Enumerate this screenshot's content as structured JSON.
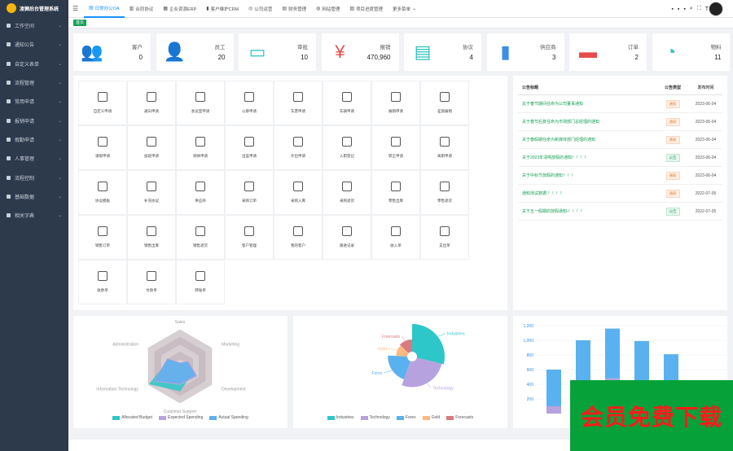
{
  "app": {
    "title": "凌狮后台管理系统"
  },
  "sidebar": {
    "items": [
      {
        "label": "工作空间"
      },
      {
        "label": "通知公告"
      },
      {
        "label": "自定义表单"
      },
      {
        "label": "流程管理"
      },
      {
        "label": "常用申请"
      },
      {
        "label": "报销申请"
      },
      {
        "label": "假勤申请"
      },
      {
        "label": "人事管理"
      },
      {
        "label": "流程控制"
      },
      {
        "label": "基础数据"
      },
      {
        "label": "相关字典"
      }
    ]
  },
  "topnav": {
    "items": [
      {
        "label": "日常办公OA",
        "icon": "doc-icon"
      },
      {
        "label": "合同协议",
        "icon": "contract-icon"
      },
      {
        "label": "企业资源ERP",
        "icon": "grid-icon"
      },
      {
        "label": "客户维护CRM",
        "icon": "bar-icon"
      },
      {
        "label": "公司运营",
        "icon": "target-icon"
      },
      {
        "label": "财务管理",
        "icon": "doc-icon"
      },
      {
        "label": "网站管理",
        "icon": "globe-icon"
      },
      {
        "label": "项目进度管理",
        "icon": "chart-icon"
      },
      {
        "label": "更多菜单",
        "icon": "chevron-down-icon"
      }
    ]
  },
  "tags": {
    "home": "首页"
  },
  "stats": [
    {
      "label": "客户",
      "value": "0",
      "color": "#2cc2bd"
    },
    {
      "label": "员工",
      "value": "20",
      "color": "#3a8ee6"
    },
    {
      "label": "审批",
      "value": "10",
      "color": "#2cc2bd"
    },
    {
      "label": "报销",
      "value": "470,960",
      "color": "#e84b4b"
    },
    {
      "label": "协议",
      "value": "4",
      "color": "#2cc2bd"
    },
    {
      "label": "供应商",
      "value": "3",
      "color": "#3a8ee6"
    },
    {
      "label": "订单",
      "value": "2",
      "color": "#e84b4b"
    },
    {
      "label": "物料",
      "value": "11",
      "color": "#2cc2bd"
    }
  ],
  "apps": [
    "自定义申请",
    "通讯申请",
    "会议室申请",
    "公章申请",
    "车票申请",
    "车辆申请",
    "报销申请",
    "差旅报销",
    "请假申请",
    "加班申请",
    "调休申请",
    "出差申请",
    "外出申请",
    "入职登记",
    "转正申请",
    "离职申请",
    "协议模板",
    "补充协议",
    "供应商",
    "采购订单",
    "采购入库",
    "采购退货",
    "零售出库",
    "零售退货",
    "销售订单",
    "销售出库",
    "销售退货",
    "客户管理",
    "我的客户",
    "跟进记录",
    "收入单",
    "支出单",
    "收款单",
    "付款单",
    "转账单"
  ],
  "notices": {
    "headers": [
      "公告标题",
      "公告类型",
      "发布时间"
    ],
    "rows": [
      {
        "title": "关于春节期间任命为公司董事通知",
        "type": "通知",
        "date": "2023-06-04"
      },
      {
        "title": "关于春节后复任命为市场部门总经理的通知",
        "type": "通知",
        "date": "2023-06-04"
      },
      {
        "title": "关于春假期任命为新媒体部门经理的通知",
        "type": "通知",
        "date": "2023-06-04"
      },
      {
        "title": "关于2023年清明放假的通知！！！！",
        "type": "公告",
        "date": "2023-06-04"
      },
      {
        "title": "关于中秋节放假的通知！！！",
        "type": "通知",
        "date": "2023-06-04"
      },
      {
        "title": "通知测试数据-！！！！",
        "type": "通知",
        "date": "2022-07-05"
      },
      {
        "title": "关于五一假期的放假通知-！！！！",
        "type": "公告",
        "date": "2022-07-05"
      }
    ]
  },
  "chart_data": [
    {
      "type": "radar",
      "indicators": [
        "Sales",
        "Marketing",
        "Development",
        "Customer Support",
        "Information Technology",
        "Administration"
      ],
      "series": [
        {
          "name": "Allocated Budget",
          "values": [
            4200,
            3000,
            20000,
            35000,
            50000,
            18000
          ],
          "color": "#2ec7c9"
        },
        {
          "name": "Expected Spending",
          "values": [
            5000,
            14000,
            28000,
            26000,
            42000,
            21000
          ],
          "color": "#b6a2de"
        },
        {
          "name": "Actual Spending",
          "values": [
            4000,
            12000,
            25000,
            24000,
            40000,
            20000
          ],
          "color": "#5ab1ef"
        }
      ],
      "legend": "bottom"
    },
    {
      "type": "pie",
      "variant": "rose",
      "categories": [
        "Industries",
        "Technology",
        "Forex",
        "Gold",
        "Forecasts"
      ],
      "values": [
        335,
        310,
        234,
        135,
        148
      ],
      "colors": [
        "#2ec7c9",
        "#b6a2de",
        "#5ab1ef",
        "#ffb980",
        "#d87a80"
      ],
      "legend": "bottom"
    },
    {
      "type": "bar",
      "stacked": true,
      "yticks": [
        "1,200",
        "1,000",
        "800",
        "600",
        "400",
        "200"
      ],
      "ylim": [
        0,
        1200
      ],
      "series": [
        {
          "values": [
            0,
            0,
            0,
            100,
            320,
            480,
            370,
            330
          ],
          "color": "#b6a2de"
        },
        {
          "values": [
            0,
            0,
            0,
            500,
            680,
            680,
            620,
            480
          ],
          "color": "#5ab1ef"
        }
      ]
    }
  ],
  "watermark": {
    "text": "会员免费下载",
    "color": "#ff1a1a"
  }
}
